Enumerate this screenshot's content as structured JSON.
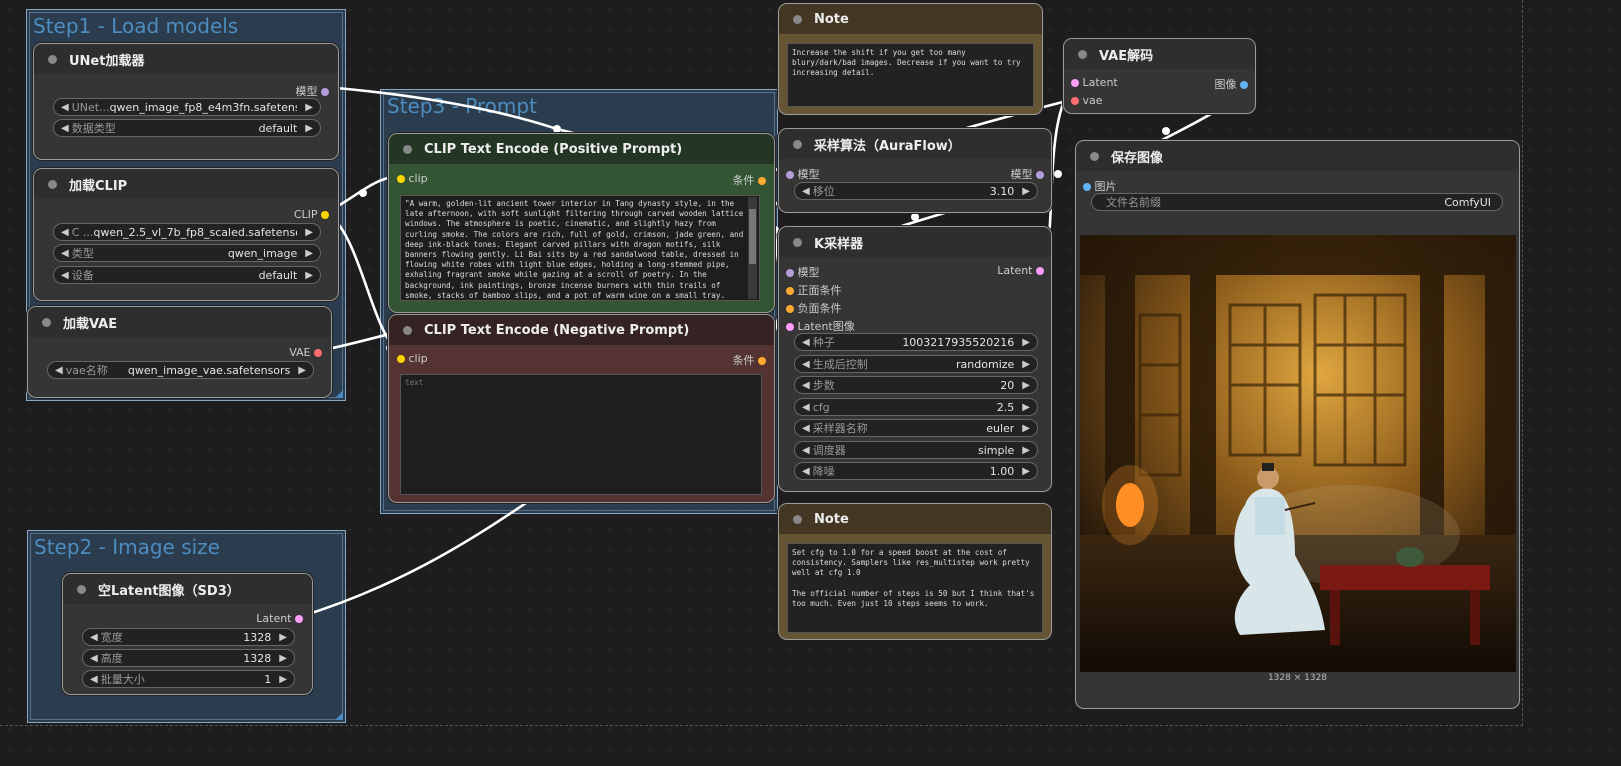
{
  "groups": {
    "step1": "Step1 - Load models",
    "step2": "Step2 - Image size",
    "step3": "Step3 - Prompt"
  },
  "unet": {
    "title": "UNet加载器",
    "out_model": "模型",
    "w1_label": "UNet...",
    "w1_value": "qwen_image_fp8_e4m3fn.safetensors",
    "w2_label": "数据类型",
    "w2_value": "default"
  },
  "clip": {
    "title": "加载CLIP",
    "out_clip": "CLIP",
    "w1_label": "C ...",
    "w1_value": "qwen_2.5_vl_7b_fp8_scaled.safetensors",
    "w2_label": "类型",
    "w2_value": "qwen_image",
    "w3_label": "设备",
    "w3_value": "default"
  },
  "vae": {
    "title": "加载VAE",
    "out_vae": "VAE",
    "w1_label": "vae名称",
    "w1_value": "qwen_image_vae.safetensors"
  },
  "latent": {
    "title": "空Latent图像（SD3）",
    "out_latent": "Latent",
    "w1_label": "宽度",
    "w1_value": "1328",
    "w2_label": "高度",
    "w2_value": "1328",
    "w3_label": "批量大小",
    "w3_value": "1"
  },
  "pos": {
    "title": "CLIP Text Encode (Positive Prompt)",
    "in_clip": "clip",
    "out_cond": "条件",
    "text": "\"A warm, golden-lit ancient tower interior in Tang dynasty style, in the late afternoon, with soft sunlight filtering through carved wooden lattice windows. The atmosphere is poetic, cinematic, and slightly hazy from curling smoke. The colors are rich, full of gold, crimson, jade green, and deep ink-black tones. Elegant carved pillars with dragon motifs, silk banners flowing gently. Li Bai sits by a red sandalwood table, dressed in flowing white robes with light blue edges, holding a long-stemmed pipe, exhaling fragrant smoke while gazing at a scroll of poetry. In the background, ink paintings, bronze incense burners with thin trails of smoke, stacks of bamboo slips, and a pot of warm wine on a small tray. Calligraphy on hanging scrolls"
  },
  "neg": {
    "title": "CLIP Text Encode (Negative Prompt)",
    "in_clip": "clip",
    "out_cond": "条件",
    "placeholder": "text"
  },
  "note1": {
    "title": "Note",
    "text": "Increase the shift if you get too many blury/dark/bad images. Decrease if you want to try increasing detail."
  },
  "note2": {
    "title": "Note",
    "text": "Set cfg to 1.0 for a speed boost at the cost of consistency. Samplers like res_multistep work pretty well at cfg 1.0\n\nThe official number of steps is 50 but I think that's too much. Even just 10 steps seems to work."
  },
  "aura": {
    "title": "采样算法（AuraFlow）",
    "in_model": "模型",
    "out_model": "模型",
    "w1_label": "移位",
    "w1_value": "3.10"
  },
  "ksampler": {
    "title": "K采样器",
    "in_model": "模型",
    "in_pos": "正面条件",
    "in_neg": "负面条件",
    "in_latent": "Latent图像",
    "out_latent": "Latent",
    "w_seed_label": "种子",
    "w_seed_value": "1003217935520216",
    "w_ctrl_label": "生成后控制",
    "w_ctrl_value": "randomize",
    "w_steps_label": "步数",
    "w_steps_value": "20",
    "w_cfg_label": "cfg",
    "w_cfg_value": "2.5",
    "w_sampler_label": "采样器名称",
    "w_sampler_value": "euler",
    "w_sched_label": "调度器",
    "w_sched_value": "simple",
    "w_denoise_label": "降噪",
    "w_denoise_value": "1.00"
  },
  "vaedecode": {
    "title": "VAE解码",
    "in_latent": "Latent",
    "in_vae": "vae",
    "out_image": "图像"
  },
  "save": {
    "title": "保存图像",
    "in_images": "图片",
    "w1_label": "文件名前缀",
    "w1_value": "ComfyUI",
    "image_caption": "1328 × 1328"
  },
  "colors": {
    "model": "#b39ddb",
    "clip": "#ffd500",
    "vae": "#ff6e6e",
    "cond": "#ffa931",
    "latent": "#ff9cf9",
    "image": "#64b5f6"
  }
}
